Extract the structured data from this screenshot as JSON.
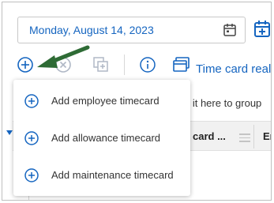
{
  "date_picker": {
    "value": "Monday, August 14, 2023",
    "calendar_icon": "calendar-icon",
    "today_icon": "calendar-today-icon"
  },
  "toolbar": {
    "add_icon": "add-circle-icon",
    "delete_icon": "delete-circle-icon",
    "copy_icon": "copy-add-icon",
    "info_icon": "info-icon",
    "time_card_label": "Time card real"
  },
  "grid": {
    "group_hint": "p it here to group",
    "columns": [
      {
        "title": "card ..."
      },
      {
        "title": "En"
      }
    ]
  },
  "add_menu": {
    "items": [
      {
        "label": "Add employee timecard",
        "icon": "add-circle-icon"
      },
      {
        "label": "Add allowance timecard",
        "icon": "add-circle-icon"
      },
      {
        "label": "Add maintenance timecard",
        "icon": "add-circle-icon"
      }
    ]
  },
  "colors": {
    "accent": "#1565c0",
    "arrow": "#2e6b35"
  }
}
